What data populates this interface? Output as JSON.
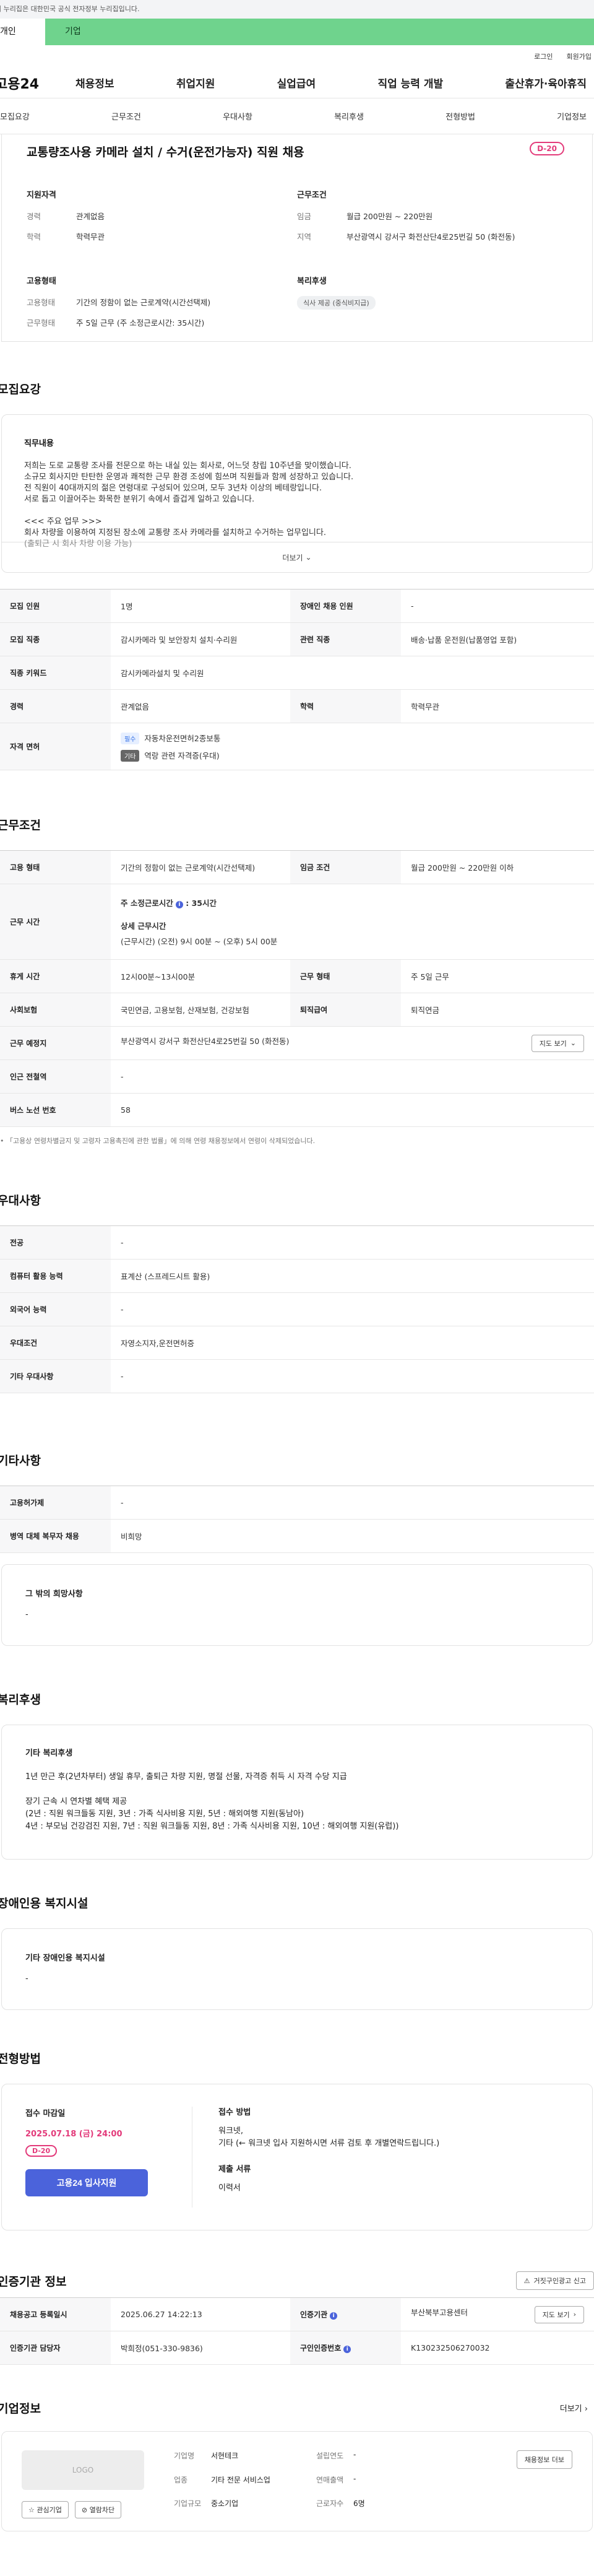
{
  "gov_banner": "이 누리집은 대한민국 공식 전자정부 누리집입니다.",
  "tabs": [
    "개인",
    "기업"
  ],
  "util": [
    "로그인",
    "회원가입"
  ],
  "logo": "고용24",
  "gnb": [
    "채용정보",
    "취업지원",
    "실업급여",
    "직업 능력 개발",
    "출산휴가·육아휴직"
  ],
  "subnav": [
    "모집요강",
    "근무조건",
    "우대사항",
    "복리후생",
    "전형방법",
    "기업정보"
  ],
  "job": {
    "title": "교통량조사용 카메라 설치 / 수거(운전가능자) 직원 채용",
    "dday": "D-20",
    "qual_h": "지원자격",
    "exp_k": "경력",
    "exp_v": "관계없음",
    "edu_k": "학력",
    "edu_v": "학력무관",
    "cond_h": "근무조건",
    "wage_k": "임금",
    "wage_v": "월급 200만원 ~ 220만원",
    "loc_k": "지역",
    "loc_v": "부산광역시 강서구 화전산단4로25번길 50 (화전동)",
    "emp_h": "고용형태",
    "emptype_k": "고용형태",
    "emptype_v": "기간의 정함이 없는 근로계약(시간선택제)",
    "workform_k": "근무형태",
    "workform_v": "주 5일 근무 (주 소정근로시간: 35시간)",
    "welfare_h": "복리후생",
    "welfare_chip": "식사 제공 (중식비지급)"
  },
  "recruit": {
    "heading": "모집요강",
    "desc_h": "직무내용",
    "desc_lines": [
      "저희는 도로 교통량 조사를 전문으로 하는 내실 있는 회사로, 어느덧 창립 10주년을 맞이했습니다.",
      "소규모 회사지만 탄탄한 운영과 쾌적한 근무 환경 조성에 힘쓰며 직원들과 함께 성장하고 있습니다.",
      "전 직원이 40대까지의 젊은 연령대로 구성되어 있으며, 모두 3년차 이상의 베테랑입니다.",
      "서로 돕고 이끌어주는 화목한 분위기 속에서 즐겁게 일하고 있습니다.",
      "",
      "<<< 주요 업무 >>>",
      "회사 차량을 이용하여 지정된 장소에 교통량 조사 카메라를 설치하고 수거하는 업무입니다.",
      "(출퇴근 시 회사 차량 이용 가능)"
    ],
    "more": "더보기",
    "rows": {
      "count_k": "모집 인원",
      "count_v": "1명",
      "disabled_k": "장애인 채용 인원",
      "disabled_v": "-",
      "job_k": "모집 직종",
      "job_v": "감시카메라 및 보안장치 설치·수리원",
      "rel_k": "관련 직종",
      "rel_v": "배송·납품 운전원(납품영업 포함)",
      "kw_k": "직종 키워드",
      "kw_v": "감시카메라설치 및 수리원",
      "exp_k": "경력",
      "exp_v": "관계없음",
      "edu_k": "학력",
      "edu_v": "학력무관",
      "lic_k": "자격 면허",
      "lic1_badge": "필수",
      "lic1": "자동차운전면허2종보통",
      "lic2_badge": "기타",
      "lic2": "역랑 관련 자격증(우대)"
    }
  },
  "cond": {
    "heading": "근무조건",
    "emp_k": "고용 형태",
    "emp_v": "기간의 정함이 없는 근로계약(시간선택제)",
    "wage_k": "임금 조건",
    "wage_v": "월급 200만원 ~ 220만원 이하",
    "time_k": "근무 시간",
    "time_l1": "주 소정근로시간",
    "time_l1v": "35시간",
    "time_l2": "상세 근무시간",
    "time_l3": "(근무시간) (오전) 9시 00분 ~ (오후) 5시 00분",
    "rest_k": "휴게 시간",
    "rest_v": "12시00분~13시00분",
    "form_k": "근무 형태",
    "form_v": "주 5일 근무",
    "ins_k": "사회보험",
    "ins_v": "국민연금, 고용보험, 산재보험, 건강보험",
    "ret_k": "퇴직급여",
    "ret_v": "퇴직연금",
    "place_k": "근무 예정지",
    "place_v": "부산광역시 강서구 화전산단4로25번길 50 (화전동)",
    "map_btn": "지도 보기",
    "sub_k": "인근 전철역",
    "sub_v": "-",
    "bus_k": "버스 노선 번호",
    "bus_v": "58",
    "note": "「고용상 연령차별금지 및 고령자 고용촉진에 관한 법률」에 의해 연령 채용정보에서 연령이 삭제되었습니다."
  },
  "pref": {
    "heading": "우대사항",
    "lang_k": "전공",
    "lang_v": "-",
    "pc_k": "컴퓨터 활용 능력",
    "pc_v": "표계산 (스프레드시트 활용)",
    "fl_k": "외국어 능력",
    "fl_v": "-",
    "cond_k": "우대조건",
    "cond_v": "자영소지자,운전면허증",
    "etc_k": "기타 우대사항",
    "etc_v": "-"
  },
  "other": {
    "heading": "기타사항",
    "hire_k": "고용허가제",
    "hire_v": "-",
    "mil_k": "병역 대체 복무자 채용",
    "mil_v": "비희망",
    "wish_h": "그 밖의 희망사항",
    "wish_v": "-"
  },
  "welfare": {
    "heading": "복리후생",
    "h": "기타 복리후생",
    "l1": "1년 만근 후(2년차부터) 생일 휴무, 출퇴근 차량 지원, 명절 선물, 자격증 취득 시 자격 수당 지급",
    "l2": "장기 근속 시 연차별 혜택 제공",
    "l3": "(2년 : 직원 워크들동 지원, 3년 : 가족 식사비용 지원, 5년 : 해외여행 지원(동남아)",
    "l4": "4년 : 부모님 건강검진 지원, 7년 : 직원 워크들동 지원, 8년 : 가족 식사비용 지원, 10년 : 해외여행 지원(유럽))"
  },
  "disab": {
    "heading": "장애인용 복지시설",
    "h": "기타 장애인용 복지시설",
    "v": "-"
  },
  "apply": {
    "heading": "전형방법",
    "deadline_h": "접수 마감일",
    "deadline": "2025.07.18 (금) 24:00",
    "dday": "D-20",
    "btn": "고용24 입사지원",
    "method_h": "접수 방법",
    "method_v1": "워크넷,",
    "method_v2": "기타 (← 워크넷 입사 지원하시면 서류 검토 후 개별연락드립니다.)",
    "docs_h": "제출 서류",
    "docs_v": "이력서"
  },
  "auth": {
    "heading": "인증기관 정보",
    "report_btn": "거짓구인광고 신고",
    "reg_k": "채용공고 등록일시",
    "reg_v": "2025.06.27 14:22:13",
    "org_k": "인증기관",
    "org_v": "부산북부고용센터",
    "map_btn": "지도 보기",
    "mgr_k": "인증기관 담당자",
    "mgr_v": "박희정(051-330-9836)",
    "num_k": "구인인증번호",
    "num_v": "K130232506270032"
  },
  "company": {
    "heading": "기업정보",
    "more": "더보기",
    "logo": "LOGO",
    "fav": "관심기업",
    "block": "열람차단",
    "name_k": "기업명",
    "name_v": "서현테크",
    "year_k": "설립연도",
    "year_v": "-",
    "ind_k": "업종",
    "ind_v": "기타 전문 서비스업",
    "sales_k": "연매출액",
    "sales_v": "-",
    "size_k": "기업규모",
    "size_v": "중소기업",
    "emp_k": "근로자수",
    "emp_v": "6명",
    "list_btn": "채용정보 더보"
  }
}
